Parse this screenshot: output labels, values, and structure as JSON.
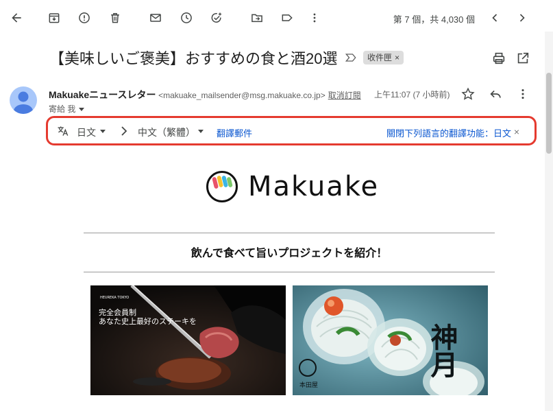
{
  "toolbar": {
    "icons": [
      "back-arrow-icon",
      "archive-icon",
      "report-spam-icon",
      "delete-icon",
      "mark-unread-icon",
      "snooze-icon",
      "add-task-icon",
      "move-to-icon",
      "label-icon",
      "more-vert-icon"
    ],
    "pager_text": "第 7 個，共 4,030 個"
  },
  "email": {
    "subject": "【美味しいご褒美】おすすめの食と酒20選",
    "label_chip": "收件匣",
    "label_remove": "×",
    "sender_name": "Makuakeニュースレター",
    "sender_address": "<makuake_mailsender@msg.makuake.co.jp>",
    "unsubscribe": "取消訂閱",
    "time": "上午11:07 (7 小時前)",
    "to_line": "寄給 我"
  },
  "translate": {
    "from_lang": "日文",
    "to_lang": "中文（繁體）",
    "translate_link": "翻譯郵件",
    "disable_link": "關閉下列語言的翻譯功能：日文",
    "close": "×"
  },
  "body": {
    "logo_text": "Makuake",
    "tagline": "飲んで食べて旨いプロジェクトを紹介！",
    "photo1_brand": "HEUREKA TOKYO",
    "photo1_line1": "完全会員制",
    "photo1_line2": "あなた史上最好のステーキを",
    "photo2_title": "神月",
    "photo2_seal": "本田屋"
  },
  "colors": {
    "accent_blue": "#0b57d0",
    "highlight_red": "#e53a2f",
    "avatar_blue": "#a8c7fa"
  }
}
